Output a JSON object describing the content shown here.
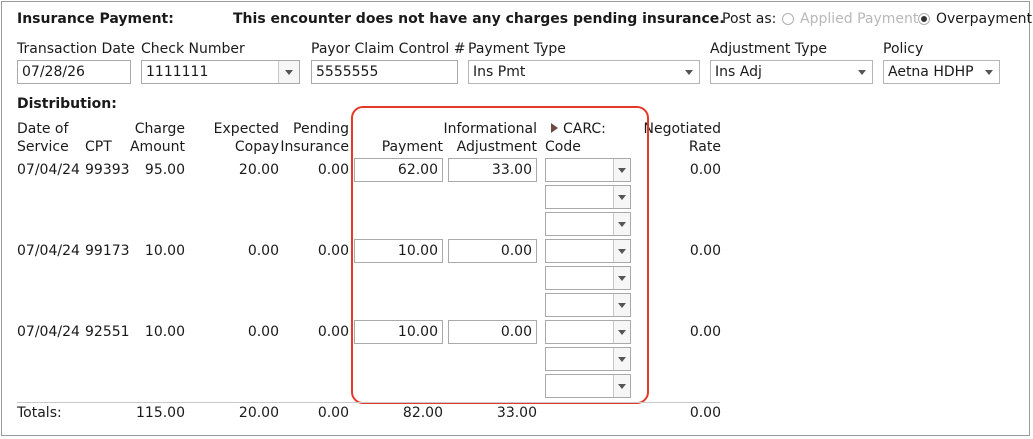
{
  "header": {
    "title": "Insurance Payment:",
    "notice": "This encounter does not have any charges pending insurance.",
    "post_as_label": "Post as:",
    "post_as_options": [
      "Applied Payment",
      "Overpayment"
    ],
    "post_as_selected": "Overpayment"
  },
  "form": {
    "transaction_date_label": "Transaction Date",
    "transaction_date": "07/28/26",
    "check_number_label": "Check Number",
    "check_number": "1111111",
    "payor_claim_label": "Payor Claim Control #",
    "payor_claim": "5555555",
    "payment_type_label": "Payment Type",
    "payment_type": "Ins Pmt",
    "adjustment_type_label": "Adjustment Type",
    "adjustment_type": "Ins Adj",
    "policy_label": "Policy",
    "policy": "Aetna HDHP"
  },
  "distribution": {
    "title": "Distribution:",
    "headers": {
      "date_l1": "Date of",
      "date_l2": "Service",
      "cpt": "CPT",
      "charge_l1": "Charge",
      "charge_l2": "Amount",
      "copay_l1": "Expected",
      "copay_l2": "Copay",
      "pending_l1": "Pending",
      "pending_l2": "Insurance",
      "payment": "Payment",
      "info_l1": "Informational",
      "info_l2": "Adjustment",
      "carc_l1": "CARC:",
      "carc_l2": "Code",
      "neg_l1": "Negotiated",
      "neg_l2": "Rate"
    },
    "rows": [
      {
        "date": "07/04/24",
        "cpt": "99393",
        "charge": "95.00",
        "copay": "20.00",
        "pending": "0.00",
        "payment": "62.00",
        "info_adj": "33.00",
        "negotiated": "0.00"
      },
      {
        "date": "07/04/24",
        "cpt": "99173",
        "charge": "10.00",
        "copay": "0.00",
        "pending": "0.00",
        "payment": "10.00",
        "info_adj": "0.00",
        "negotiated": "0.00"
      },
      {
        "date": "07/04/24",
        "cpt": "92551",
        "charge": "10.00",
        "copay": "0.00",
        "pending": "0.00",
        "payment": "10.00",
        "info_adj": "0.00",
        "negotiated": "0.00"
      }
    ],
    "totals": {
      "label": "Totals:",
      "charge": "115.00",
      "copay": "20.00",
      "pending": "0.00",
      "payment": "82.00",
      "info_adj": "33.00",
      "negotiated": "0.00"
    }
  },
  "colors": {
    "highlight": "#e53a2a",
    "border": "#9a9a9a",
    "disabled_text": "#b8b8b8"
  },
  "icons": [
    "chevron-down-icon",
    "expand-triangle-icon",
    "radio-icon"
  ]
}
